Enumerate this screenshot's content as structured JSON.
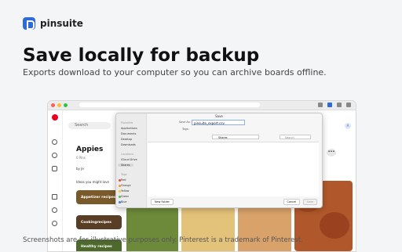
{
  "brand": {
    "name": "pinsuite"
  },
  "hero": {
    "headline": "Save locally for backup",
    "subline": "Exports download to your computer so you can archive boards offline."
  },
  "browser": {
    "search_placeholder": "Search",
    "board": {
      "title": "Appies",
      "subtitle": "0 Pins",
      "by_label": "by Je",
      "ideas_label": "Ideas you might love",
      "idea_cards": [
        "Appetizer recipes",
        "Cookingrecipes",
        "Healthy recipes"
      ]
    },
    "avatar_letter": "A",
    "more_label": "•••"
  },
  "save_dialog": {
    "title": "Save",
    "save_as_label": "Save As:",
    "filename": "pinsuite_export.csv",
    "tags_label": "Tags:",
    "location": "Shares",
    "search_placeholder": "Search",
    "sidebar_sections": [
      {
        "heading": "Favorites",
        "items": [
          "Applications",
          "Documents",
          "Desktop",
          "Downloads"
        ]
      },
      {
        "heading": "Locations",
        "items": [
          "iCloud Drive",
          "Shares"
        ]
      },
      {
        "heading": "Tags",
        "items": [
          "Red",
          "Orange",
          "Yellow",
          "Green",
          "Blue"
        ]
      }
    ],
    "selected_item": "Shares",
    "tag_colors": [
      "#e5453b",
      "#f39a2b",
      "#f2cf2c",
      "#4cbf4b",
      "#3a82f0"
    ],
    "new_folder_label": "New Folder",
    "cancel_label": "Cancel",
    "save_label": "Save"
  },
  "footer": {
    "text": "Screenshots are for illustrative purposes only. Pinterest is a trademark of Pinterest."
  },
  "colors": {
    "accent": "#2f6bd8",
    "pinterest_red": "#e60023"
  }
}
